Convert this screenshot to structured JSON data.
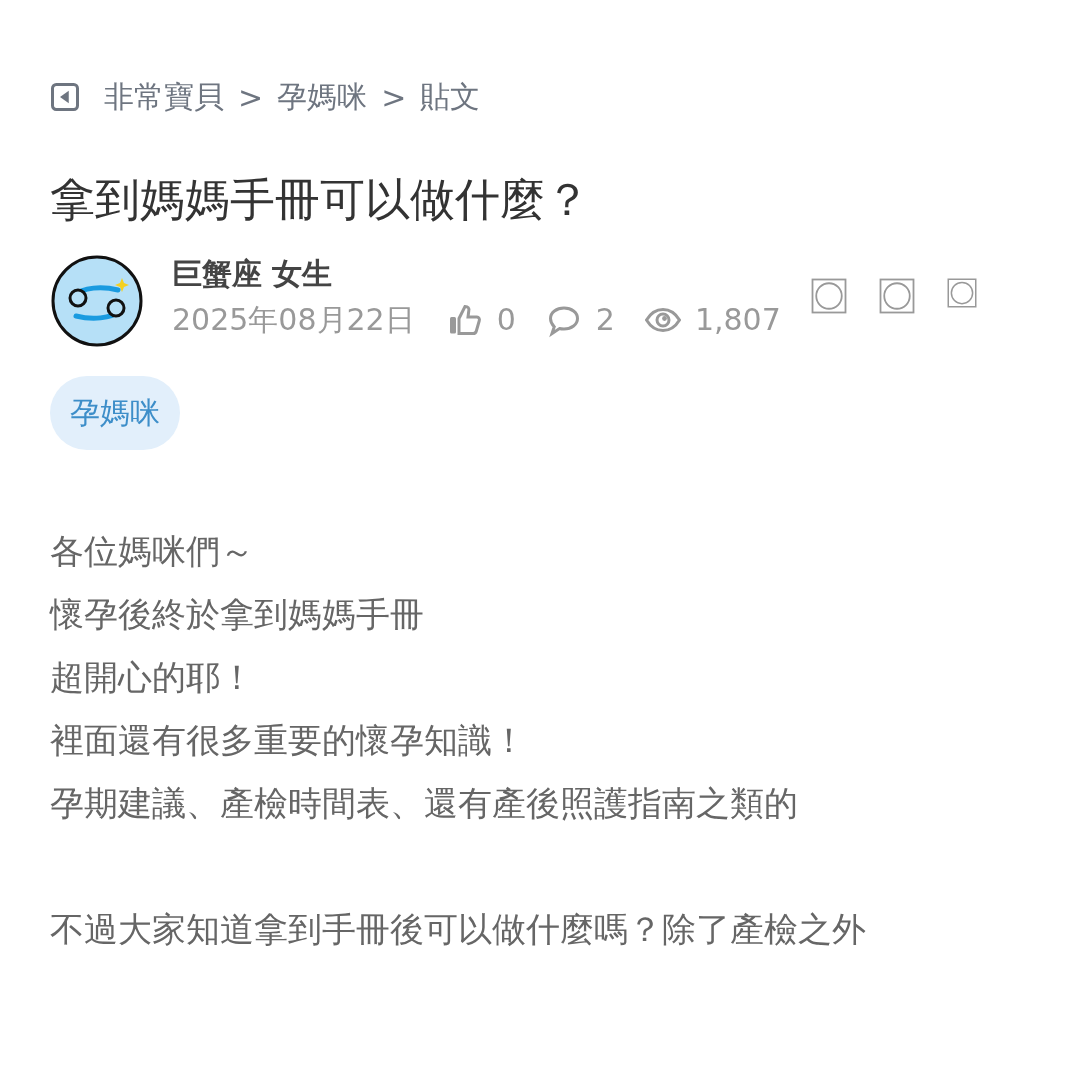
{
  "breadcrumb": [
    "非常寶貝",
    "孕媽咪",
    "貼文"
  ],
  "separator": ">",
  "title": "拿到媽媽手冊可以做什麼？",
  "author": {
    "name": "巨蟹座 女生",
    "date": "2025年08月22日"
  },
  "stats": [
    {
      "kind": "likes",
      "value": "0"
    },
    {
      "kind": "comments",
      "value": "2"
    },
    {
      "kind": "views",
      "value": "1,807"
    }
  ],
  "actions": [
    {
      "kind": "large"
    },
    {
      "kind": "large"
    },
    {
      "kind": "small"
    }
  ],
  "tags": [
    "孕媽咪"
  ],
  "body": [
    [
      "各位媽咪們～",
      "懷孕後終於拿到媽媽手冊",
      "超開心的耶！",
      "裡面還有很多重要的懷孕知識！",
      "孕期建議、產檢時間表、還有產後照護指南之類的"
    ],
    [
      "不過大家知道拿到手冊後可以做什麼嗎？除了產檢之外"
    ]
  ]
}
